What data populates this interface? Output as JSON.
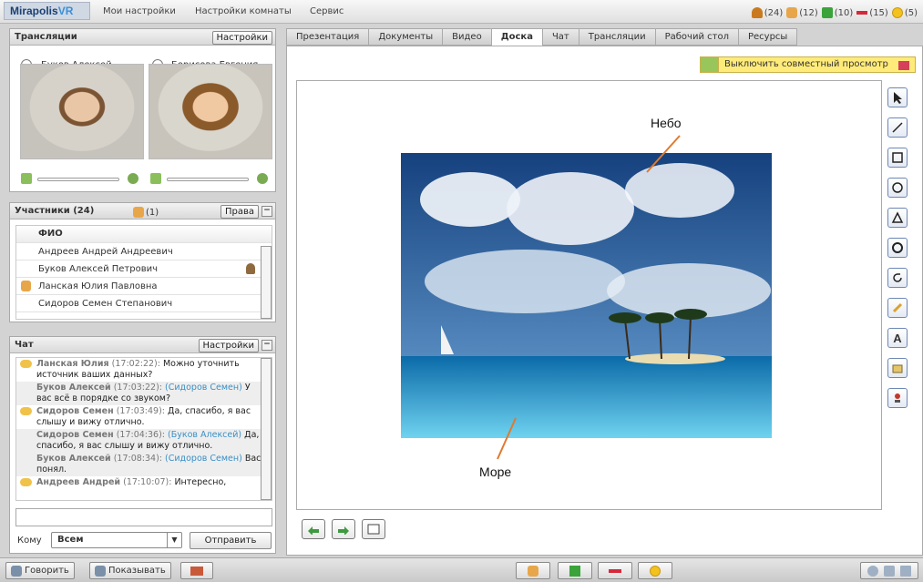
{
  "topbar": {
    "logo_main": "Mirapolis",
    "logo_vr": "VR",
    "menu": [
      "Мои настройки",
      "Настройки комнаты",
      "Сервис"
    ],
    "stats": [
      {
        "icon": "person-icon",
        "value": "(24)",
        "color": "#e08a1e"
      },
      {
        "icon": "hand-icon",
        "value": "(12)",
        "color": "#e8a64a"
      },
      {
        "icon": "plus-icon",
        "value": "(10)",
        "color": "#3aa33a"
      },
      {
        "icon": "minus-icon",
        "value": "(15)",
        "color": "#d6283a"
      },
      {
        "icon": "smile-icon",
        "value": "(5)",
        "color": "#f3c21d"
      }
    ]
  },
  "broadcasts": {
    "title": "Трансляции",
    "settings_label": "Настройки",
    "people": [
      {
        "name": "Буков Алексей"
      },
      {
        "name": "Борисова Евгения"
      }
    ]
  },
  "participants": {
    "title": "Участники (24)",
    "hand_count": "(1)",
    "rights_label": "Права",
    "minimize_label": "−",
    "column_header": "ФИО",
    "rows": [
      {
        "name": "Андреев Андрей Андреевич",
        "hand": false,
        "speaker": false
      },
      {
        "name": "Буков Алексей Петрович",
        "hand": false,
        "speaker": true
      },
      {
        "name": "Ланская Юлия Павловна",
        "hand": true,
        "speaker": false
      },
      {
        "name": "Сидоров Семен Степанович",
        "hand": false,
        "speaker": false
      }
    ]
  },
  "chat": {
    "title": "Чат",
    "settings_label": "Настройки",
    "minimize_label": "−",
    "messages": [
      {
        "name": "Ланская Юлия",
        "time": "(17:02:22):",
        "reply": "",
        "text": "Можно уточнить источник ваших данных?",
        "bubble": true
      },
      {
        "name": "Буков Алексей",
        "time": "(17:03:22):",
        "reply": "(Сидоров Семен)",
        "text": "У вас всё в порядке со звуком?",
        "bubble": false
      },
      {
        "name": "Сидоров Семен",
        "time": "(17:03:49):",
        "reply": "",
        "text": "Да, спасибо, я вас слышу и вижу отлично.",
        "bubble": true
      },
      {
        "name": "Сидоров Семен",
        "time": "(17:04:36):",
        "reply": "(Буков Алексей)",
        "text": "Да, спасибо, я вас слышу и вижу отлично.",
        "bubble": false
      },
      {
        "name": "Буков Алексей",
        "time": "(17:08:34):",
        "reply": "(Сидоров Семен)",
        "text": "Вас понял.",
        "bubble": false
      },
      {
        "name": "Андреев Андрей",
        "time": "(17:10:07):",
        "reply": "",
        "text": "Интересно,",
        "bubble": true
      }
    ],
    "to_label": "Кому",
    "to_value": "Всем",
    "send_label": "Отправить",
    "input_value": ""
  },
  "tabs": [
    "Презентация",
    "Документы",
    "Видео",
    "Доска",
    "Чат",
    "Трансляции",
    "Рабочий стол",
    "Ресурсы"
  ],
  "active_tab": "Доска",
  "board": {
    "shared_view_label": "Выключить совместный просмотр",
    "label_sky": "Небо",
    "label_sea": "Море",
    "tools": [
      "cursor-icon",
      "line-icon",
      "rectangle-icon",
      "circle-icon",
      "triangle-icon",
      "filled-circle-icon",
      "rotate-icon",
      "pencil-icon",
      "text-icon",
      "stamp-icon",
      "marker-icon"
    ]
  },
  "bottombar": {
    "speak_label": "Говорить",
    "show_label": "Показывать"
  }
}
